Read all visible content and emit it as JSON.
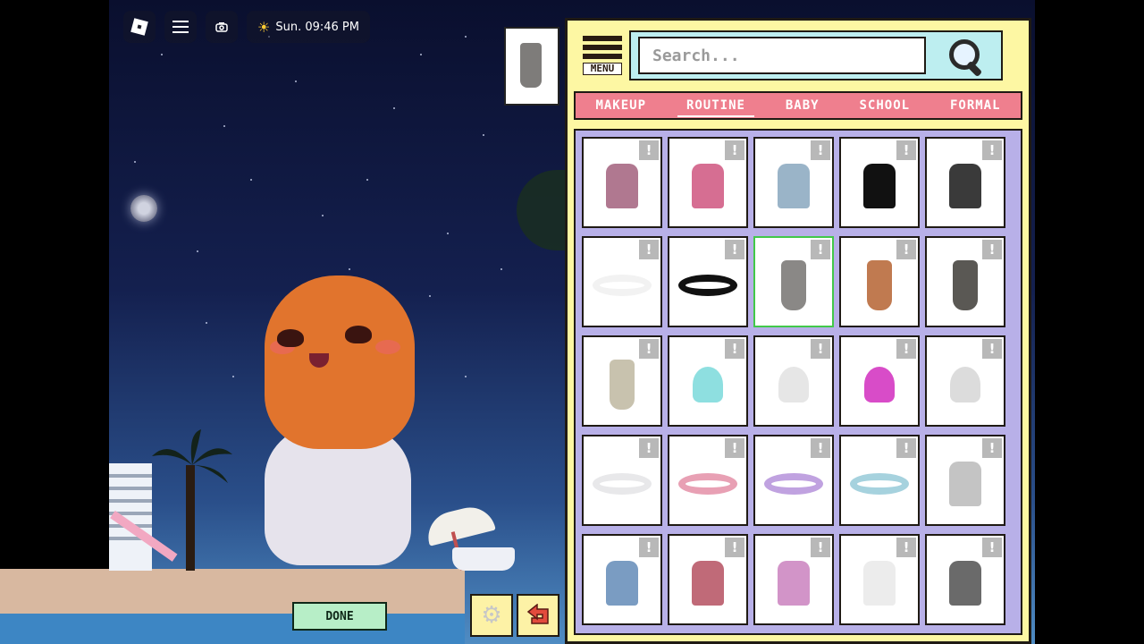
{
  "hud": {
    "time": "Sun. 09:46 PM",
    "icons": [
      "roblox-logo-icon",
      "hamburger-icon",
      "camera-icon",
      "sun-icon"
    ]
  },
  "panel": {
    "menu_label": "MENU",
    "search_placeholder": "Search...",
    "tabs": [
      {
        "label": "MAKEUP",
        "active": false
      },
      {
        "label": "ROUTINE",
        "active": true
      },
      {
        "label": "BABY",
        "active": false
      },
      {
        "label": "SCHOOL",
        "active": false
      },
      {
        "label": "FORMAL",
        "active": false
      }
    ],
    "info_glyph": "!"
  },
  "items": [
    {
      "kind": "robe",
      "color": "#b07890"
    },
    {
      "kind": "robe",
      "color": "#d66e92"
    },
    {
      "kind": "robe",
      "color": "#9ab4c8"
    },
    {
      "kind": "robe",
      "color": "#111111"
    },
    {
      "kind": "robe",
      "color": "#3a3a3a"
    },
    {
      "kind": "ring",
      "color": "#f2f2f2"
    },
    {
      "kind": "ring",
      "color": "#111111"
    },
    {
      "kind": "towelwrap",
      "color": "#8a8886",
      "selected": true
    },
    {
      "kind": "towelwrap",
      "color": "#c07a50"
    },
    {
      "kind": "towelwrap",
      "color": "#5a5854"
    },
    {
      "kind": "towelwrap",
      "color": "#c8c2ae"
    },
    {
      "kind": "cap",
      "color": "#8edfe0"
    },
    {
      "kind": "cap",
      "color": "#e6e6e6"
    },
    {
      "kind": "cap",
      "color": "#d84cc8"
    },
    {
      "kind": "cap",
      "color": "#dcdcdc"
    },
    {
      "kind": "ring",
      "color": "#e8e8ea"
    },
    {
      "kind": "ring",
      "color": "#e8a0b4"
    },
    {
      "kind": "ring",
      "color": "#c0a2e0"
    },
    {
      "kind": "ring",
      "color": "#a6d2de"
    },
    {
      "kind": "robe",
      "color": "#c4c4c4"
    },
    {
      "kind": "robe",
      "color": "#7a9cc2"
    },
    {
      "kind": "robe",
      "color": "#c06a78"
    },
    {
      "kind": "robe",
      "color": "#d294c8"
    },
    {
      "kind": "robe",
      "color": "#ececec"
    },
    {
      "kind": "robe",
      "color": "#6a6a6a"
    }
  ],
  "buttons": {
    "done_label": "DONE"
  }
}
